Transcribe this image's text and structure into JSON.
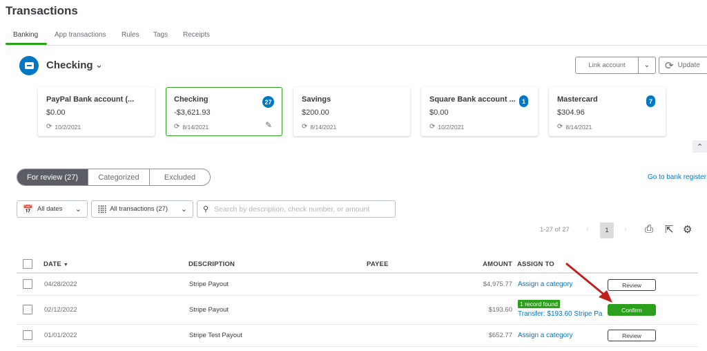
{
  "page": {
    "title": "Transactions"
  },
  "tabs": [
    {
      "label": "Banking",
      "active": true
    },
    {
      "label": "App transactions"
    },
    {
      "label": "Rules"
    },
    {
      "label": "Tags"
    },
    {
      "label": "Receipts"
    }
  ],
  "account_selector": {
    "name": "Checking",
    "icon": "bank-card-icon"
  },
  "header_buttons": {
    "link_account": "Link account",
    "update": "Update"
  },
  "accounts": [
    {
      "name": "PayPal Bank account (...",
      "balance": "$0.00",
      "synced": "10/2/2021",
      "badge": null,
      "selected": false
    },
    {
      "name": "Checking",
      "balance": "-$3,621.93",
      "synced": "8/14/2021",
      "badge": "27",
      "selected": true
    },
    {
      "name": "Savings",
      "balance": "$200.00",
      "synced": "8/14/2021",
      "badge": null,
      "selected": false
    },
    {
      "name": "Square Bank account ...",
      "balance": "$0.00",
      "synced": "10/2/2021",
      "badge": "1",
      "selected": false
    },
    {
      "name": "Mastercard",
      "balance": "$304.96",
      "synced": "8/14/2021",
      "badge": "7",
      "selected": false
    }
  ],
  "review_tabs": [
    {
      "label": "For review (27)",
      "active": true
    },
    {
      "label": "Categorized"
    },
    {
      "label": "Excluded"
    }
  ],
  "go_to_register": "Go to bank register",
  "filters": {
    "dates": "All dates",
    "transactions": "All transactions (27)",
    "search_placeholder": "Search by description, check number, or amount",
    "search_value": ""
  },
  "pagination": {
    "range": "1-27 of 27",
    "current_page": "1",
    "prev": "‹",
    "next": "›"
  },
  "table": {
    "columns": {
      "date": "DATE",
      "sort_indicator": "▼",
      "description": "DESCRIPTION",
      "payee": "PAYEE",
      "amount": "AMOUNT",
      "assign_to": "ASSIGN TO"
    },
    "rows": [
      {
        "date": "04/28/2022",
        "description": "Stripe Payout",
        "payee": "",
        "amount": "$4,975.77",
        "assign": "Assign a category",
        "action": "Review"
      },
      {
        "date": "02/12/2022",
        "description": "Stripe Payout",
        "payee": "",
        "amount": "$193.60",
        "match_badge": "1 record found",
        "assign": "Transfer: $193.60 Stripe Pa",
        "action": "Confirm"
      },
      {
        "date": "01/01/2022",
        "description": "Stripe Test Payout",
        "payee": "",
        "amount": "$652.77",
        "assign": "Assign a category",
        "action": "Review"
      }
    ]
  },
  "colors": {
    "accent_green": "#2ca01c",
    "link_blue": "#0077c5",
    "annotation_arrow": "#c0201d"
  }
}
